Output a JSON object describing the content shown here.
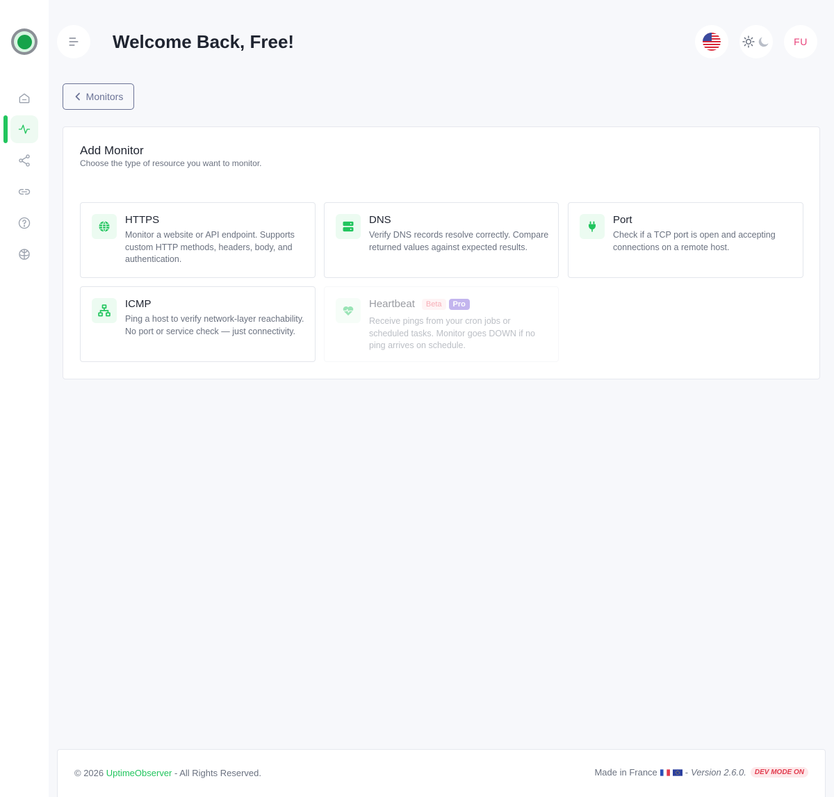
{
  "header": {
    "title": "Welcome Back, Free!",
    "avatar_initials": "FU"
  },
  "nav": {
    "back_label": "Monitors"
  },
  "add_monitor": {
    "title": "Add Monitor",
    "subtitle": "Choose the type of resource you want to monitor.",
    "types": [
      {
        "title": "HTTPS",
        "description": "Monitor a website or API endpoint. Supports custom HTTP methods, headers, body, and authentication.",
        "icon": "globe-icon"
      },
      {
        "title": "DNS",
        "description": "Verify DNS records resolve correctly. Compare returned values against expected results.",
        "icon": "server-icon"
      },
      {
        "title": "Port",
        "description": "Check if a TCP port is open and accepting connections on a remote host.",
        "icon": "plug-icon"
      },
      {
        "title": "ICMP",
        "description": "Ping a host to verify network-layer reachability. No port or service check — just connectivity.",
        "icon": "network-icon"
      },
      {
        "title": "Heartbeat",
        "description": "Receive pings from your cron jobs or scheduled tasks. Monitor goes DOWN if no ping arrives on schedule.",
        "icon": "heart-pulse-icon",
        "badge_beta": "Beta",
        "badge_pro": "Pro",
        "disabled": true
      }
    ]
  },
  "footer": {
    "copyright": "© 2026 ",
    "brand": "UptimeObserver",
    "rights": " - All Rights Reserved.",
    "made_in": "Made in France",
    "version_sep": " - ",
    "version": "Version 2.6.0.",
    "dev_mode": "DEV MODE ON"
  },
  "colors": {
    "accent": "#22c55e",
    "back_border": "#6b7396",
    "pro_badge": "#7c5cdb",
    "beta_badge": "#ef4b5f",
    "avatar_text": "#e8457c"
  }
}
